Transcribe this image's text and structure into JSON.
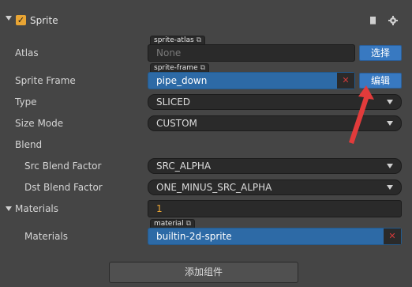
{
  "component": {
    "title": "Sprite",
    "enabled_mark": "✓",
    "expand_icon": "triangle-down",
    "help_icon": "book-icon",
    "settings_icon": "gear-icon"
  },
  "rows": {
    "atlas": {
      "label": "Atlas",
      "tag": "sprite-atlas",
      "value": "None",
      "button": "选择"
    },
    "sprite_frame": {
      "label": "Sprite Frame",
      "tag": "sprite-frame",
      "value": "pipe_down",
      "button": "编辑",
      "clear": "✕"
    },
    "type": {
      "label": "Type",
      "value": "SLICED"
    },
    "size_mode": {
      "label": "Size Mode",
      "value": "CUSTOM"
    },
    "blend": {
      "label": "Blend"
    },
    "src_blend": {
      "label": "Src Blend Factor",
      "value": "SRC_ALPHA"
    },
    "dst_blend": {
      "label": "Dst Blend Factor",
      "value": "ONE_MINUS_SRC_ALPHA"
    },
    "materials_group": {
      "label": "Materials",
      "count": "1"
    },
    "material": {
      "label": "Materials",
      "tag": "material",
      "value": "builtin-2d-sprite",
      "clear": "✕"
    }
  },
  "add_component": "添加组件",
  "colors": {
    "accent_orange": "#e9a534",
    "button_blue": "#3879c1",
    "field_blue": "#2d6aa6",
    "annotation_red": "#e23b3b"
  }
}
